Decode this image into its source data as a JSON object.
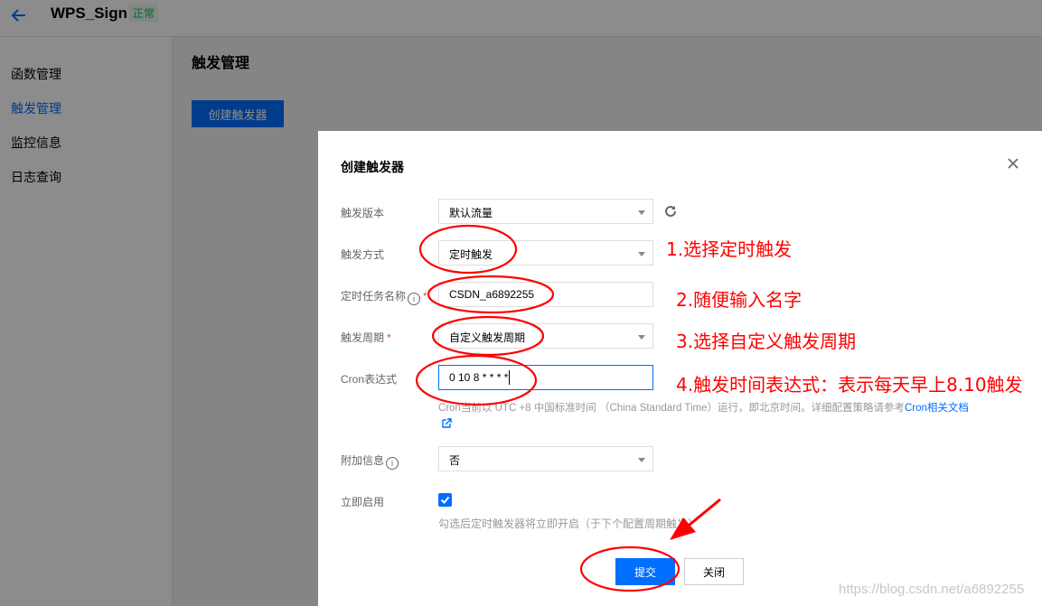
{
  "header": {
    "back_icon": "arrow-left-icon",
    "title": "WPS_Sign",
    "status_badge": "正常"
  },
  "sidebar": {
    "items": [
      {
        "label": "函数管理",
        "active": false
      },
      {
        "label": "触发管理",
        "active": true
      },
      {
        "label": "监控信息",
        "active": false
      },
      {
        "label": "日志查询",
        "active": false
      }
    ]
  },
  "main": {
    "title": "触发管理",
    "create_button": "创建触发器"
  },
  "modal": {
    "title": "创建触发器",
    "close_icon": "close-icon",
    "fields": {
      "version": {
        "label": "触发版本",
        "value": "默认流量"
      },
      "method": {
        "label": "触发方式",
        "value": "定时触发"
      },
      "task_name": {
        "label": "定时任务名称",
        "value": "CSDN_a6892255",
        "required": true
      },
      "period": {
        "label": "触发周期",
        "value": "自定义触发周期",
        "required": true
      },
      "cron": {
        "label": "Cron表达式",
        "value": "0 10 8 * * * *"
      },
      "extra_info": {
        "label": "附加信息",
        "value": "否"
      },
      "enable_now": {
        "label": "立即启用",
        "checked": true
      }
    },
    "cron_help": "Cron当前以 UTC +8 中国标准时间 （China Standard Time）运行，即北京时间。详细配置策略请参考",
    "cron_help_link": "Cron相关文档",
    "enable_help": "勾选后定时触发器将立即开启（于下个配置周期触发）",
    "submit_button": "提交",
    "close_button": "关闭"
  },
  "annotations": [
    "1.选择定时触发",
    "2.随便输入名字",
    "3.选择自定义触发周期",
    "4.触发时间表达式：表示每天早上8.10触发"
  ],
  "colors": {
    "accent": "#006eff",
    "annotation": "#ff0000",
    "success": "#0abf5b"
  },
  "watermark": "https://blog.csdn.net/a6892255"
}
